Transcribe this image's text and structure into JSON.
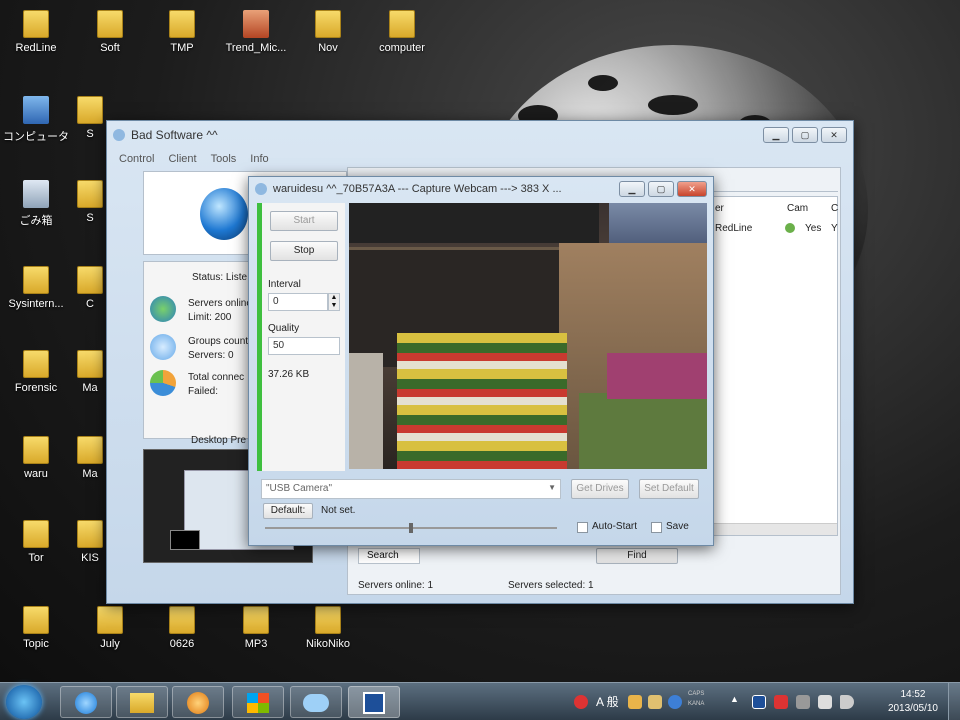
{
  "desktop": {
    "icons": [
      {
        "label": "RedLine",
        "icon": "folder-icon"
      },
      {
        "label": "Soft",
        "icon": "folder-icon"
      },
      {
        "label": "TMP",
        "icon": "folder-icon"
      },
      {
        "label": "Trend_Mic...",
        "icon": "gift-icon"
      },
      {
        "label": "Nov",
        "icon": "folder-icon"
      },
      {
        "label": "computer",
        "icon": "folder-icon"
      },
      {
        "label": "コンピュータ",
        "icon": "computer-icon"
      },
      {
        "label": "ごみ箱",
        "icon": "trash-icon"
      },
      {
        "label": "Sysintern...",
        "icon": "folder-icon"
      },
      {
        "label": "Forensic",
        "icon": "folder-icon"
      },
      {
        "label": "waru",
        "icon": "folder-icon"
      },
      {
        "label": "Tor",
        "icon": "folder-icon"
      },
      {
        "label": "Topic",
        "icon": "folder-icon"
      },
      {
        "label": "July",
        "icon": "folder-icon"
      },
      {
        "label": "0626",
        "icon": "folder-icon"
      },
      {
        "label": "MP3",
        "icon": "folder-icon"
      },
      {
        "label": "NikoNiko",
        "icon": "folder-icon"
      },
      {
        "label": "S",
        "icon": "folder-icon"
      },
      {
        "label": "S",
        "icon": "folder-icon"
      },
      {
        "label": "C",
        "icon": "folder-icon"
      },
      {
        "label": "Ma",
        "icon": "folder-icon"
      },
      {
        "label": "Ma",
        "icon": "folder-icon"
      },
      {
        "label": "KIS",
        "icon": "folder-icon"
      }
    ]
  },
  "main_window": {
    "title": "Bad Software ^^",
    "menu": [
      "Control",
      "Client",
      "Tools",
      "Info"
    ],
    "status_title": "Status: Liste",
    "stats": [
      {
        "line1": "Servers online",
        "line2": "Limit: 200",
        "icon": "globe-icon"
      },
      {
        "line1": "Groups count",
        "line2": "Servers: 0",
        "icon": "cloud-icon"
      },
      {
        "line1": "Total connec",
        "line2": "Failed:",
        "icon": "pie-icon"
      }
    ],
    "desktop_preview_label": "Desktop Pre",
    "table_headers": [
      "er",
      "Cam",
      "C"
    ],
    "table_row": {
      "user": "RedLine",
      "cam": "Yes",
      "extra": "Y"
    },
    "search_label": "Search",
    "find_label": "Find",
    "status_servers_online": "Servers online: 1",
    "status_servers_selected": "Servers selected: 1"
  },
  "webcam_window": {
    "title": "waruidesu ^^_70B57A3A --- Capture Webcam ---> 383 X ...",
    "start_label": "Start",
    "stop_label": "Stop",
    "interval_label": "Interval",
    "interval_value": "0",
    "quality_label": "Quality",
    "quality_value": "50",
    "size_text": "37.26 KB",
    "device_value": "\"USB Camera\"",
    "get_drives_label": "Get Drives",
    "set_default_label": "Set Default",
    "default_label": "Default:",
    "default_value": "Not set.",
    "auto_start_label": "Auto-Start",
    "save_label": "Save"
  },
  "taskbar": {
    "ime_text": "A 般",
    "caps_text": "CAPS",
    "kana_text": "KANA",
    "time": "14:52",
    "date": "2013/05/10"
  }
}
